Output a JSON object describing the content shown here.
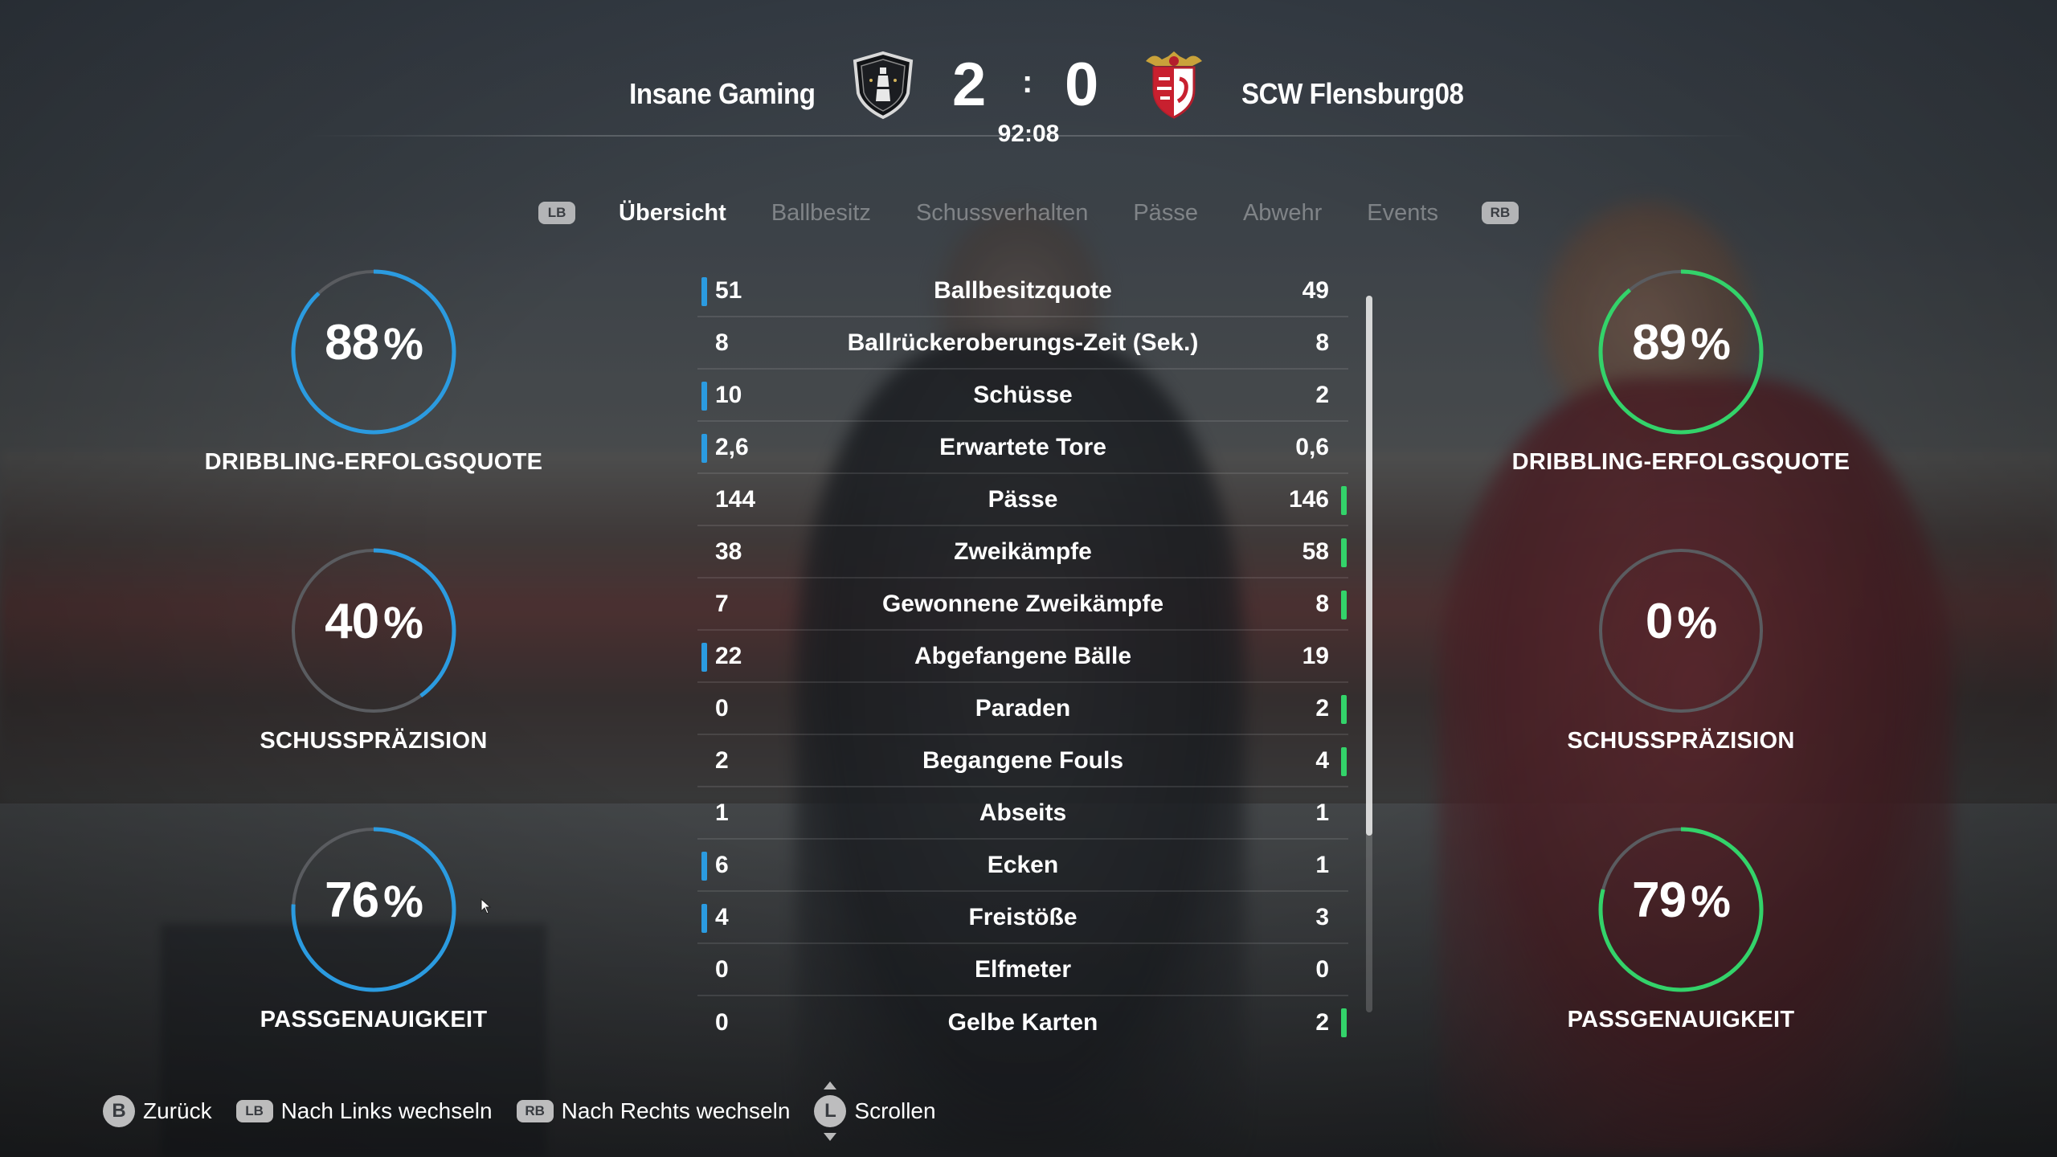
{
  "match": {
    "home_team": "Insane Gaming",
    "away_team": "SCW Flensburg08",
    "home_score": "2",
    "score_separator": ":",
    "away_score": "0",
    "clock": "92:08"
  },
  "tabs": {
    "left_shoulder": "LB",
    "right_shoulder": "RB",
    "items": [
      "Übersicht",
      "Ballbesitz",
      "Schussverhalten",
      "Pässe",
      "Abwehr",
      "Events"
    ],
    "active": "Übersicht"
  },
  "gauges": {
    "percent_sign": "%",
    "home": [
      {
        "value": "88",
        "label": "DRIBBLING-ERFOLGSQUOTE"
      },
      {
        "value": "40",
        "label": "SCHUSSPRÄZISION"
      },
      {
        "value": "76",
        "label": "PASSGENAUIGKEIT"
      }
    ],
    "away": [
      {
        "value": "89",
        "label": "DRIBBLING-ERFOLGSQUOTE"
      },
      {
        "value": "0",
        "label": "SCHUSSPRÄZISION"
      },
      {
        "value": "79",
        "label": "PASSGENAUIGKEIT"
      }
    ]
  },
  "stats": [
    {
      "name": "Ballbesitzquote",
      "home": "51",
      "away": "49",
      "leader": "home"
    },
    {
      "name": "Ballrückeroberungs-Zeit (Sek.)",
      "home": "8",
      "away": "8",
      "leader": "none"
    },
    {
      "name": "Schüsse",
      "home": "10",
      "away": "2",
      "leader": "home"
    },
    {
      "name": "Erwartete Tore",
      "home": "2,6",
      "away": "0,6",
      "leader": "home"
    },
    {
      "name": "Pässe",
      "home": "144",
      "away": "146",
      "leader": "away"
    },
    {
      "name": "Zweikämpfe",
      "home": "38",
      "away": "58",
      "leader": "away"
    },
    {
      "name": "Gewonnene Zweikämpfe",
      "home": "7",
      "away": "8",
      "leader": "away"
    },
    {
      "name": "Abgefangene Bälle",
      "home": "22",
      "away": "19",
      "leader": "home"
    },
    {
      "name": "Paraden",
      "home": "0",
      "away": "2",
      "leader": "away"
    },
    {
      "name": "Begangene Fouls",
      "home": "2",
      "away": "4",
      "leader": "away"
    },
    {
      "name": "Abseits",
      "home": "1",
      "away": "1",
      "leader": "none"
    },
    {
      "name": "Ecken",
      "home": "6",
      "away": "1",
      "leader": "home"
    },
    {
      "name": "Freistöße",
      "home": "4",
      "away": "3",
      "leader": "home"
    },
    {
      "name": "Elfmeter",
      "home": "0",
      "away": "0",
      "leader": "none"
    },
    {
      "name": "Gelbe Karten",
      "home": "0",
      "away": "2",
      "leader": "away"
    }
  ],
  "footer": {
    "back_button": "B",
    "back_label": "Zurück",
    "left_button": "LB",
    "left_label": "Nach Links wechseln",
    "right_button": "RB",
    "right_label": "Nach Rechts wechseln",
    "scroll_button": "L",
    "scroll_label": "Scrollen"
  },
  "colors": {
    "home_accent": "#2b9be0",
    "away_accent": "#33d36a",
    "ring_track": "#5a5c60"
  },
  "icons": {
    "home_crest": "insane-gaming-crest-icon",
    "away_crest": "scw-flensburg-crest-icon"
  }
}
